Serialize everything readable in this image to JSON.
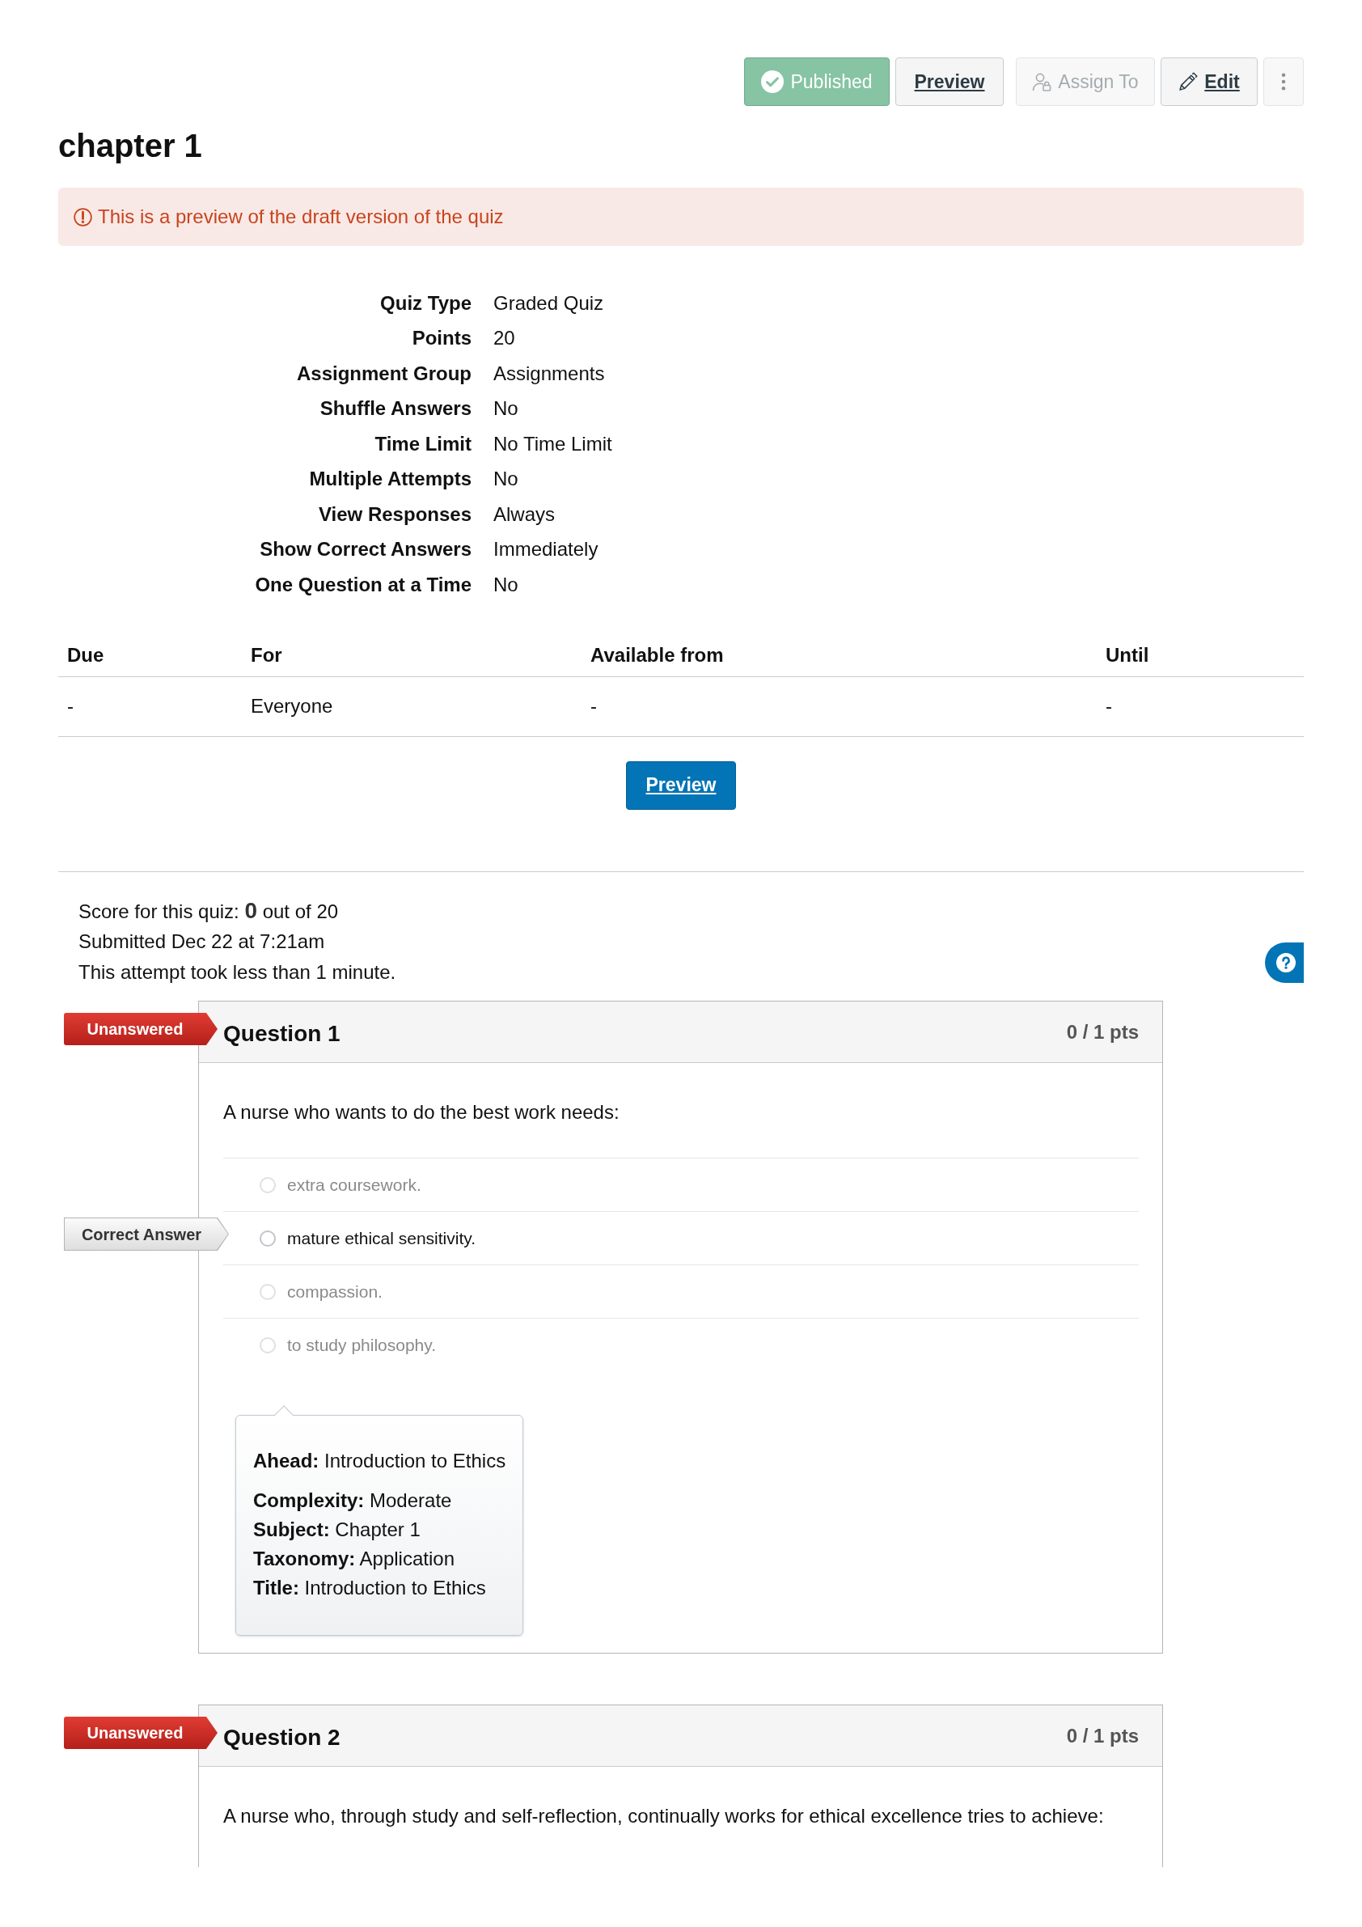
{
  "toolbar": [
    {
      "kind": "published",
      "label": "Published",
      "on": true,
      "disabled": false
    },
    {
      "kind": "preview",
      "label": "Preview",
      "disabled": false
    },
    {
      "kind": "assign",
      "label": "Assign To",
      "disabled": true
    },
    {
      "kind": "edit",
      "label": "Edit",
      "disabled": false
    },
    {
      "kind": "more",
      "disabled": false
    }
  ],
  "title": "chapter 1",
  "alert": "This is a preview of the draft version of the quiz",
  "details": [
    {
      "label": "Quiz Type",
      "value": "Graded Quiz"
    },
    {
      "label": "Points",
      "value": "20"
    },
    {
      "label": "Assignment Group",
      "value": "Assignments"
    },
    {
      "label": "Shuffle Answers",
      "value": "No"
    },
    {
      "label": "Time Limit",
      "value": "No Time Limit"
    },
    {
      "label": "Multiple Attempts",
      "value": "No"
    },
    {
      "label": "View Responses",
      "value": "Always"
    },
    {
      "label": "Show Correct Answers",
      "value": "Immediately"
    },
    {
      "label": "One Question at a Time",
      "value": "No"
    }
  ],
  "dates_table": {
    "columns": [
      "Due",
      "For",
      "Available from",
      "Until"
    ],
    "rows": [
      [
        "-",
        "Everyone",
        "-",
        "-"
      ]
    ]
  },
  "preview_button": "Preview",
  "results": {
    "score": "Score for this quiz: **0** out of 20",
    "submitted": "Submitted Dec 22 at 7:21am",
    "duration": "This attempt took less than 1 minute."
  },
  "questions": [
    {
      "status": {
        "kind": "unanswered",
        "label": "Unanswered"
      },
      "title": "Question 1",
      "points": "0 / 1 pts",
      "text": "A nurse who wants to do the best work needs:",
      "correct_label": "Correct Answer",
      "answers": [
        {
          "text": "extra coursework.",
          "correct": false,
          "selected": false
        },
        {
          "text": "mature ethical sensitivity.",
          "correct": true,
          "selected": false
        },
        {
          "text": "compassion.",
          "correct": false,
          "selected": false
        },
        {
          "text": "to study philosophy.",
          "correct": false,
          "selected": false
        }
      ],
      "meta_heading": "**Ahead:** Introduction to Ethics",
      "meta": [
        "**Complexity:** Moderate",
        "**Subject:** Chapter 1",
        "**Taxonomy:** Application",
        "**Title:** Introduction to Ethics"
      ]
    },
    {
      "status": {
        "kind": "unanswered",
        "label": "Unanswered"
      },
      "title": "Question 2",
      "points": "0 / 1 pts",
      "text": "A nurse who, through study and self-reflection, continually works for ethical excellence tries to achieve:"
    }
  ]
}
